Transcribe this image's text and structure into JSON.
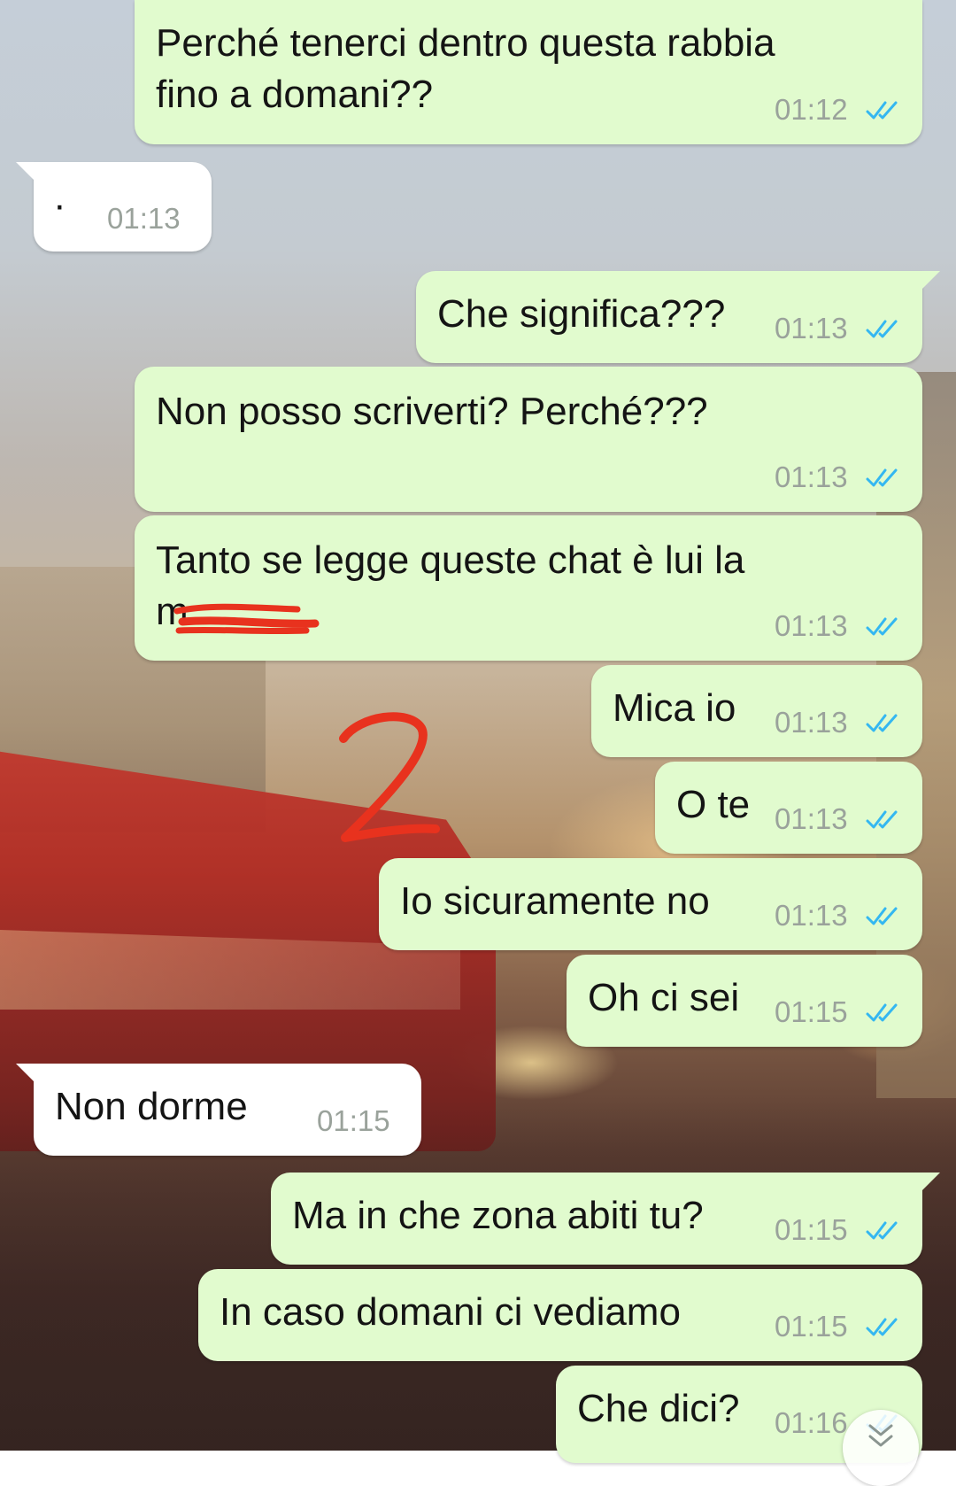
{
  "messages": [
    {
      "direction": "out",
      "text_line1": "Perché tenerci dentro questa rabbia",
      "text_line2": "fino a domani??",
      "time": "01:12",
      "status": "read"
    },
    {
      "direction": "in",
      "text": "·",
      "time": "01:13"
    },
    {
      "direction": "out",
      "text": "Che significa???",
      "time": "01:13",
      "status": "read"
    },
    {
      "direction": "out",
      "text": "Non posso scriverti? Perché???",
      "time": "01:13",
      "status": "read"
    },
    {
      "direction": "out",
      "text_line1": "Tanto se legge queste chat è lui la",
      "text_line2": "m",
      "time": "01:13",
      "status": "read",
      "redacted": true
    },
    {
      "direction": "out",
      "text": "Mica io",
      "time": "01:13",
      "status": "read"
    },
    {
      "direction": "out",
      "text": "O te",
      "time": "01:13",
      "status": "read"
    },
    {
      "direction": "out",
      "text": "Io sicuramente no",
      "time": "01:13",
      "status": "read"
    },
    {
      "direction": "out",
      "text": "Oh ci sei",
      "time": "01:15",
      "status": "read"
    },
    {
      "direction": "in",
      "text": "Non dorme",
      "time": "01:15"
    },
    {
      "direction": "out",
      "text": "Ma in che zona abiti tu?",
      "time": "01:15",
      "status": "read"
    },
    {
      "direction": "out",
      "text": "In caso domani ci vediamo",
      "time": "01:15",
      "status": "read"
    },
    {
      "direction": "out",
      "text": "Che dici?",
      "time": "01:16",
      "status": "read"
    }
  ],
  "annotation": {
    "label": "2",
    "color": "#e8321e"
  },
  "colors": {
    "outgoing_bubble": "#e1fbce",
    "incoming_bubble": "#ffffff",
    "read_ticks": "#34b7f1",
    "timestamp": "#9aa29b"
  },
  "icons": {
    "read_receipt": "double-check-icon",
    "scroll_down": "chevron-double-down-icon"
  }
}
